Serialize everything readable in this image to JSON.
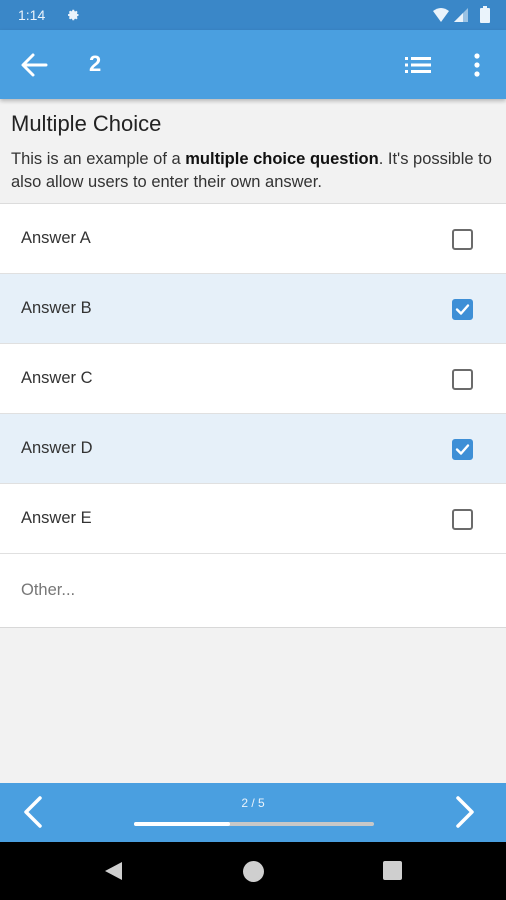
{
  "status_bar": {
    "time": "1:14",
    "icons": [
      "settings-gear-icon",
      "wifi-icon",
      "signal-icon",
      "battery-icon"
    ]
  },
  "app_bar": {
    "title": "2",
    "icons": [
      "arrow-back-icon",
      "list-icon",
      "more-vertical-icon"
    ]
  },
  "question": {
    "title": "Multiple Choice",
    "description_prefix": "This is an example of a ",
    "description_bold": "multiple choice question",
    "description_suffix": ". It's possible to also allow users to enter their own answer."
  },
  "answers": [
    {
      "label": "Answer A",
      "checked": false
    },
    {
      "label": "Answer B",
      "checked": true
    },
    {
      "label": "Answer C",
      "checked": false
    },
    {
      "label": "Answer D",
      "checked": true
    },
    {
      "label": "Answer E",
      "checked": false
    }
  ],
  "other": {
    "placeholder": "Other...",
    "value": ""
  },
  "footer": {
    "progress_text": "2 / 5",
    "progress_fraction": 0.4,
    "icons": [
      "chevron-left-icon",
      "chevron-right-icon"
    ]
  },
  "colors": {
    "status_bar": "#3a87c8",
    "app_bar": "#4a9fe0",
    "selected_row": "#e6f0f9",
    "checkbox_checked": "#3e8fd6"
  }
}
